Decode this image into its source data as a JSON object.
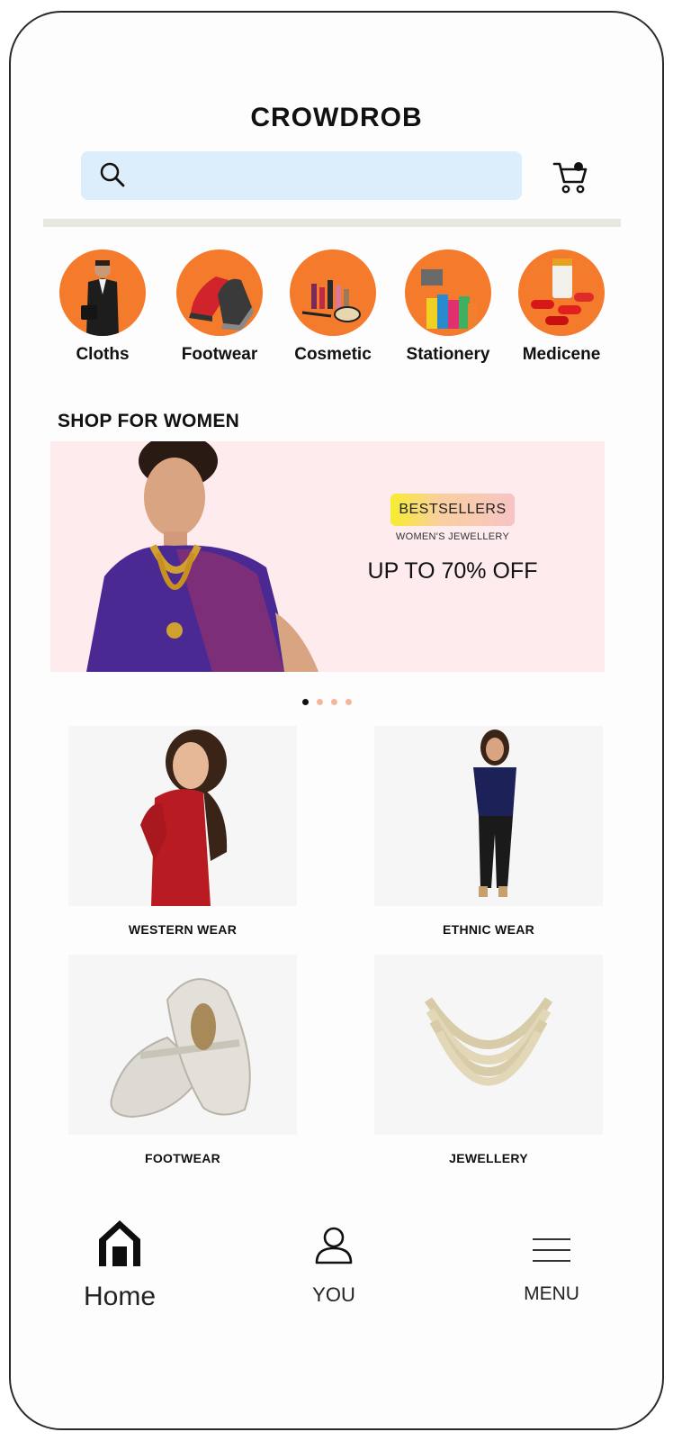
{
  "header": {
    "logo": "CROWDROB"
  },
  "search": {
    "placeholder": ""
  },
  "categories": [
    {
      "label": "Cloths"
    },
    {
      "label": "Footwear"
    },
    {
      "label": "Cosmetic"
    },
    {
      "label": "Stationery"
    },
    {
      "label": "Medicene"
    }
  ],
  "section": {
    "title": "SHOP FOR WOMEN"
  },
  "banner": {
    "badge": "BESTSELLERS",
    "subtitle": "WOMEN'S JEWELLERY",
    "offer": "UP TO 70% OFF"
  },
  "carousel": {
    "pages": 4,
    "active": 0
  },
  "tiles": [
    {
      "caption": "WESTERN WEAR"
    },
    {
      "caption": "ETHNIC WEAR"
    },
    {
      "caption": "FOOTWEAR"
    },
    {
      "caption": "JEWELLERY"
    }
  ],
  "bottom_nav": [
    {
      "label": "Home",
      "icon": "home-icon"
    },
    {
      "label": "YOU",
      "icon": "user-icon"
    },
    {
      "label": "MENU",
      "icon": "menu-icon"
    }
  ],
  "colors": {
    "accent": "#f47a2c",
    "search_bg": "#dcedfb",
    "banner_bg": "#fdebee"
  }
}
